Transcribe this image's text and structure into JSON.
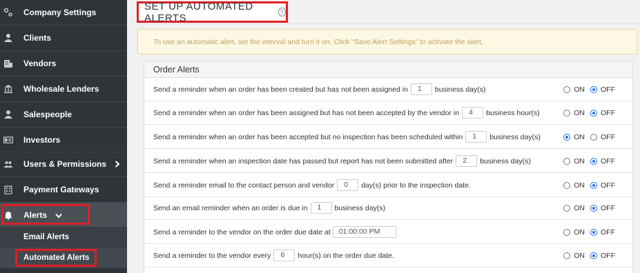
{
  "sidebar": {
    "items": [
      {
        "label": "Company Settings",
        "icon": "gears-icon",
        "glyph": "⚙"
      },
      {
        "label": "Clients",
        "icon": "user-icon",
        "glyph": "👤"
      },
      {
        "label": "Vendors",
        "icon": "building-icon",
        "glyph": "▦"
      },
      {
        "label": "Wholesale Lenders",
        "icon": "bank-icon",
        "glyph": "🏛"
      },
      {
        "label": "Salespeople",
        "icon": "user-icon",
        "glyph": "👤"
      },
      {
        "label": "Investors",
        "icon": "id-card-icon",
        "glyph": "▣"
      },
      {
        "label": "Users & Permissions",
        "icon": "users-icon",
        "glyph": "👥",
        "chevron": "›"
      },
      {
        "label": "Payment Gateways",
        "icon": "calculator-icon",
        "glyph": "▦"
      },
      {
        "label": "Alerts",
        "icon": "bell-icon",
        "glyph": "🔔",
        "chevron": "⌄"
      }
    ],
    "subitems": [
      {
        "label": "Email Alerts"
      },
      {
        "label": "Automated Alerts"
      }
    ]
  },
  "header": {
    "title": "SET UP AUTOMATED ALERTS",
    "help_glyph": "?"
  },
  "notice": {
    "text": "To use an automatic alert, set the interval and turn it on. Click \"Save Alert Settings\" to activate the alert."
  },
  "panel": {
    "title": "Order Alerts",
    "on_label": "ON",
    "off_label": "OFF",
    "rows": [
      {
        "before": "Send a reminder when an order has been created but has not been assigned in",
        "value": "1",
        "after": "business day(s)",
        "state": "off"
      },
      {
        "before": "Send a reminder when an order has been assigned but has not been accepted by the vendor in",
        "value": "4",
        "after": "business hour(s)",
        "state": "off"
      },
      {
        "before": "Send a reminder when an order has been accepted but no inspection has been scheduled within",
        "value": "1",
        "after": "business day(s)",
        "state": "on"
      },
      {
        "before": "Send a reminder when an inspection date has passed but report has not been submitted after",
        "value": "2",
        "after": "business day(s)",
        "state": "off"
      },
      {
        "before": "Send a reminder email to the contact person and vendor",
        "value": "0",
        "after": "day(s) prior to the inspection date.",
        "state": "off"
      },
      {
        "before": "Send an email reminder when an order is due in",
        "value": "1",
        "after": "business day(s)",
        "state": "off"
      },
      {
        "before": "Send a reminder to the vendor on the order due date at",
        "time": "01:00:00 PM",
        "after": "",
        "state": "off"
      },
      {
        "before": "Send a reminder to the vendor every",
        "value": "6",
        "after": "hour(s) on the order due date.",
        "state": "off"
      }
    ]
  },
  "colors": {
    "sidebar_bg": "#2f3439",
    "highlight_red": "#e01e26",
    "radio_blue": "#1e73e8",
    "notice_bg": "#fcf8e3"
  }
}
